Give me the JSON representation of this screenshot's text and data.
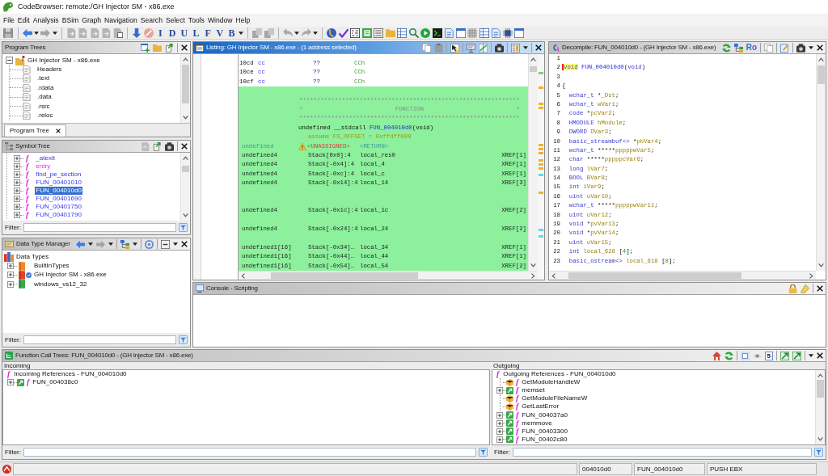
{
  "window": {
    "title": "CodeBrowser: remote:/GH Injector SM - x86.exe"
  },
  "menu": [
    "File",
    "Edit",
    "Analysis",
    "BSim",
    "Graph",
    "Navigation",
    "Search",
    "Select",
    "Tools",
    "Window",
    "Help"
  ],
  "toolbar": {
    "letters": [
      "I",
      "D",
      "U",
      "L",
      "F",
      "V",
      "B"
    ]
  },
  "program_trees": {
    "title": "Program Trees",
    "focused": false,
    "tree": {
      "label": "GH Injector SM - x86.exe",
      "expanded": true,
      "children": [
        {
          "label": "Headers"
        },
        {
          "label": ".text"
        },
        {
          "label": ".rdata"
        },
        {
          "label": ".data"
        },
        {
          "label": ".rsrc"
        },
        {
          "label": ".reloc"
        }
      ]
    },
    "tabs": [
      {
        "label": "Program Tree",
        "selected": true
      }
    ]
  },
  "symbol_tree": {
    "title": "Symbol Tree",
    "focused": false,
    "items": [
      {
        "glyph": "f",
        "label": "_atexit",
        "kind": "function",
        "expanded": false,
        "selected": false
      },
      {
        "glyph": "f",
        "label": "entry",
        "kind": "entry",
        "expanded": false,
        "selected": false
      },
      {
        "glyph": "f",
        "label": "find_pe_section",
        "kind": "function",
        "expanded": false,
        "selected": false
      },
      {
        "glyph": "f",
        "label": "FUN_00401010",
        "kind": "function",
        "expanded": false,
        "selected": false
      },
      {
        "glyph": "f",
        "label": "FUN_004010d0",
        "kind": "function",
        "expanded": false,
        "selected": true
      },
      {
        "glyph": "f",
        "label": "FUN_00401690",
        "kind": "function",
        "expanded": false,
        "selected": false
      },
      {
        "glyph": "f",
        "label": "FUN_00401750",
        "kind": "function",
        "expanded": false,
        "selected": false
      },
      {
        "glyph": "f",
        "label": "FUN_00401790",
        "kind": "function",
        "expanded": false,
        "selected": false
      }
    ],
    "filter": {
      "label": "Filter:"
    }
  },
  "data_type_manager": {
    "title": "Data Type Manager",
    "focused": false,
    "tree": {
      "label": "Data Types",
      "children": [
        {
          "label": "BuiltInTypes",
          "kind": "builtin",
          "expanded": false
        },
        {
          "label": "GH Injector SM - x86.exe",
          "kind": "program",
          "expanded": false
        },
        {
          "label": "windows_vs12_32",
          "kind": "archive",
          "expanded": false
        }
      ]
    },
    "filter": {
      "label": "Filter:"
    }
  },
  "listing": {
    "title": "Listing:  GH Injector SM - x86.exe - (1 address selected)",
    "focused": true,
    "byte_rows": [
      {
        "address": "10cd",
        "bytes": "cc",
        "mnemonic": "??",
        "operand": "CCh"
      },
      {
        "address": "10ce",
        "bytes": "cc",
        "mnemonic": "??",
        "operand": "CCh"
      },
      {
        "address": "10cf",
        "bytes": "cc",
        "mnemonic": "??",
        "operand": "CCh"
      }
    ],
    "function": {
      "border_top": "**************************************************************",
      "banner": "*                          FUNCTION                          *",
      "border_bottom": "**************************************************************",
      "signature": [
        {
          "kind": "plain",
          "text": "undefined __stdcall "
        },
        {
          "kind": "func",
          "text": "FUN_004010d0"
        },
        {
          "kind": "plain",
          "text": "(void)"
        }
      ],
      "assume": "assume FS_OFFSET = 0xffdff000",
      "return_value": {
        "type": "undefined",
        "warning": true,
        "storage": "<UNASSIGNED>",
        "name": "<RETURN>"
      }
    },
    "variables": [
      {
        "kind": "var",
        "type": "undefined4",
        "storage": "Stack[0x0]:4",
        "name": "local_res0",
        "xref": "XREF[1]"
      },
      {
        "kind": "var",
        "type": "undefined4",
        "storage": "Stack[-0x4]:4",
        "name": "local_4",
        "xref": "XREF[1]"
      },
      {
        "kind": "var",
        "type": "undefined4",
        "storage": "Stack[-0xc]:4",
        "name": "local_c",
        "xref": "XREF[1]"
      },
      {
        "kind": "var",
        "type": "undefined4",
        "storage": "Stack[-0x14]:4",
        "name": "local_14",
        "xref": "XREF[3]"
      },
      {
        "kind": "blank"
      },
      {
        "kind": "blank"
      },
      {
        "kind": "var",
        "type": "undefined4",
        "storage": "Stack[-0x1c]:4",
        "name": "local_1c",
        "xref": "XREF[2]"
      },
      {
        "kind": "blank"
      },
      {
        "kind": "var",
        "type": "undefined4",
        "storage": "Stack[-0x24]:4",
        "name": "local_24",
        "xref": "XREF[2]"
      },
      {
        "kind": "blank"
      },
      {
        "kind": "var",
        "type": "undefined1[16]",
        "storage": "Stack[-0x34]…",
        "name": "local_34",
        "xref": "XREF[1]"
      },
      {
        "kind": "var",
        "type": "undefined1[16]",
        "storage": "Stack[-0x44]…",
        "name": "local_44",
        "xref": "XREF[1]"
      },
      {
        "kind": "var",
        "type": "undefined1[16]",
        "storage": "Stack[-0x54]…",
        "name": "local_54",
        "xref": "XREF[2]"
      }
    ]
  },
  "decompile": {
    "title": "Decompile: FUN_004010d0 -  (GH Injector SM - x86.exe)",
    "focused": false,
    "tool_label": "Ro",
    "lines": [
      {
        "number": "1"
      },
      {
        "number": "2",
        "indented": false,
        "tokens": [
          {
            "kind": "cursor",
            "text": "void"
          },
          {
            "kind": "func",
            "text": " FUN_004010d0"
          },
          {
            "kind": "plain",
            "text": "("
          },
          {
            "kind": "type",
            "text": "void"
          },
          {
            "kind": "plain",
            "text": ")"
          }
        ]
      },
      {
        "number": "3"
      },
      {
        "number": "4",
        "indented": false,
        "tokens": [
          {
            "kind": "plain",
            "text": "{"
          }
        ]
      },
      {
        "number": "5",
        "indented": true,
        "tokens": [
          {
            "kind": "type",
            "text": "wchar_t "
          },
          {
            "kind": "plain",
            "text": "*"
          },
          {
            "kind": "var",
            "text": "_Dst"
          },
          {
            "kind": "plain",
            "text": ";"
          }
        ]
      },
      {
        "number": "6",
        "indented": true,
        "tokens": [
          {
            "kind": "type",
            "text": "wchar_t "
          },
          {
            "kind": "var",
            "text": "wVar1"
          },
          {
            "kind": "plain",
            "text": ";"
          }
        ]
      },
      {
        "number": "7",
        "indented": true,
        "tokens": [
          {
            "kind": "type",
            "text": "code "
          },
          {
            "kind": "plain",
            "text": "*"
          },
          {
            "kind": "var",
            "text": "pcVar2"
          },
          {
            "kind": "plain",
            "text": ";"
          }
        ]
      },
      {
        "number": "8",
        "indented": true,
        "tokens": [
          {
            "kind": "type",
            "text": "HMODULE "
          },
          {
            "kind": "var",
            "text": "hModule"
          },
          {
            "kind": "plain",
            "text": ";"
          }
        ]
      },
      {
        "number": "9",
        "indented": true,
        "tokens": [
          {
            "kind": "type",
            "text": "DWORD "
          },
          {
            "kind": "var",
            "text": "DVar3"
          },
          {
            "kind": "plain",
            "text": ";"
          }
        ]
      },
      {
        "number": "10",
        "indented": true,
        "tokens": [
          {
            "kind": "type",
            "text": "basic_streambuf<> "
          },
          {
            "kind": "plain",
            "text": "*"
          },
          {
            "kind": "var",
            "text": "pbVar4"
          },
          {
            "kind": "plain",
            "text": ";"
          }
        ]
      },
      {
        "number": "11",
        "indented": true,
        "tokens": [
          {
            "kind": "type",
            "text": "wchar_t "
          },
          {
            "kind": "plain",
            "text": "*****"
          },
          {
            "kind": "var",
            "text": "pppppwVar5"
          },
          {
            "kind": "plain",
            "text": ";"
          }
        ]
      },
      {
        "number": "12",
        "indented": true,
        "tokens": [
          {
            "kind": "type",
            "text": "char "
          },
          {
            "kind": "plain",
            "text": "*****"
          },
          {
            "kind": "var",
            "text": "pppppcVar6"
          },
          {
            "kind": "plain",
            "text": ";"
          }
        ]
      },
      {
        "number": "13",
        "indented": true,
        "tokens": [
          {
            "kind": "type",
            "text": "long "
          },
          {
            "kind": "var",
            "text": "lVar7"
          },
          {
            "kind": "plain",
            "text": ";"
          }
        ]
      },
      {
        "number": "14",
        "indented": true,
        "tokens": [
          {
            "kind": "type",
            "text": "BOOL "
          },
          {
            "kind": "var",
            "text": "BVar8"
          },
          {
            "kind": "plain",
            "text": ";"
          }
        ]
      },
      {
        "number": "15",
        "indented": true,
        "tokens": [
          {
            "kind": "type",
            "text": "int "
          },
          {
            "kind": "var",
            "text": "iVar9"
          },
          {
            "kind": "plain",
            "text": ";"
          }
        ]
      },
      {
        "number": "16",
        "indented": true,
        "tokens": [
          {
            "kind": "type",
            "text": "uint "
          },
          {
            "kind": "var",
            "text": "uVar10"
          },
          {
            "kind": "plain",
            "text": ";"
          }
        ]
      },
      {
        "number": "17",
        "indented": true,
        "tokens": [
          {
            "kind": "type",
            "text": "wchar_t "
          },
          {
            "kind": "plain",
            "text": "*****"
          },
          {
            "kind": "var",
            "text": "pppppwVar11"
          },
          {
            "kind": "plain",
            "text": ";"
          }
        ]
      },
      {
        "number": "18",
        "indented": true,
        "tokens": [
          {
            "kind": "type",
            "text": "uint "
          },
          {
            "kind": "var",
            "text": "uVar12"
          },
          {
            "kind": "plain",
            "text": ";"
          }
        ]
      },
      {
        "number": "19",
        "indented": true,
        "tokens": [
          {
            "kind": "type",
            "text": "void "
          },
          {
            "kind": "plain",
            "text": "*"
          },
          {
            "kind": "var",
            "text": "pvVar13"
          },
          {
            "kind": "plain",
            "text": ";"
          }
        ]
      },
      {
        "number": "20",
        "indented": true,
        "tokens": [
          {
            "kind": "type",
            "text": "void "
          },
          {
            "kind": "plain",
            "text": "*"
          },
          {
            "kind": "var",
            "text": "pvVar14"
          },
          {
            "kind": "plain",
            "text": ";"
          }
        ]
      },
      {
        "number": "21",
        "indented": true,
        "tokens": [
          {
            "kind": "type",
            "text": "uint "
          },
          {
            "kind": "var",
            "text": "uVar15"
          },
          {
            "kind": "plain",
            "text": ";"
          }
        ]
      },
      {
        "number": "22",
        "indented": true,
        "tokens": [
          {
            "kind": "type",
            "text": "int "
          },
          {
            "kind": "var",
            "text": "local_628"
          },
          {
            "kind": "plain",
            "text": " ["
          },
          {
            "kind": "num",
            "text": "4"
          },
          {
            "kind": "plain",
            "text": "];"
          }
        ]
      },
      {
        "number": "23",
        "indented": true,
        "tokens": [
          {
            "kind": "type",
            "text": "basic_ostream<> "
          },
          {
            "kind": "var",
            "text": "local_618"
          },
          {
            "kind": "plain",
            "text": " ["
          },
          {
            "kind": "num",
            "text": "8"
          },
          {
            "kind": "plain",
            "text": "];"
          }
        ]
      }
    ]
  },
  "console": {
    "title": "Console - Scripting",
    "focused": false
  },
  "call_trees": {
    "title": "Function Call Trees: FUN_004010d0 -  (GH Injector SM - x86.exe)",
    "focused": false,
    "depth": "5",
    "incoming": {
      "label": "Incoming",
      "root": {
        "glyph": "f",
        "label": "Incoming References - FUN_004010d0"
      },
      "items": [
        {
          "kind": "internal",
          "expanded": false,
          "glyph": "f",
          "label": "FUN_004038c0"
        }
      ],
      "filter": {
        "label": "Filter:"
      }
    },
    "outgoing": {
      "label": "Outgoing",
      "root": {
        "glyph": "f",
        "label": "Outgoing References - FUN_004010d0"
      },
      "items": [
        {
          "kind": "external",
          "glyph": "f",
          "label": "GetModuleHandleW"
        },
        {
          "kind": "internal",
          "expanded": false,
          "glyph": "f",
          "label": "memset"
        },
        {
          "kind": "external",
          "glyph": "f",
          "label": "GetModuleFileNameW"
        },
        {
          "kind": "external",
          "glyph": "f",
          "label": "GetLastError"
        },
        {
          "kind": "internal",
          "expanded": false,
          "glyph": "f",
          "label": "FUN_004037a0"
        },
        {
          "kind": "internal",
          "expanded": false,
          "glyph": "f",
          "label": "memmove"
        },
        {
          "kind": "internal",
          "expanded": false,
          "glyph": "f",
          "label": "FUN_00403300"
        },
        {
          "kind": "internal",
          "expanded": false,
          "glyph": "f",
          "label": "FUN_00402c80"
        }
      ],
      "filter": {
        "label": "Filter:"
      }
    }
  },
  "status_bar": {
    "fields": [
      "004010d0",
      "FUN_004010d0",
      "PUSH EBX"
    ]
  }
}
